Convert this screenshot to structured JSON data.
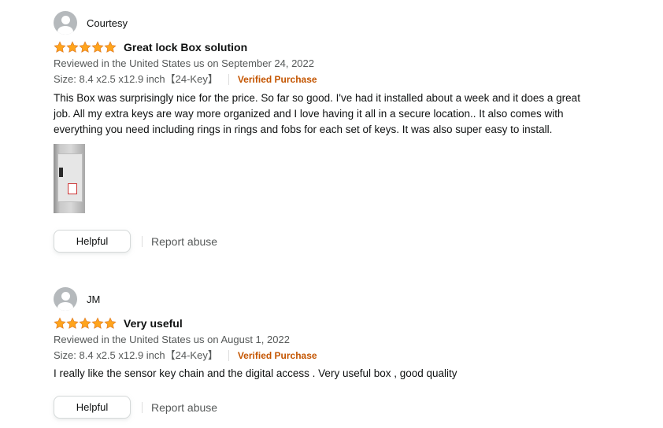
{
  "colors": {
    "star": "#ffa41c",
    "verified": "#c45500",
    "meta_text": "#565959",
    "avatar_bg": "#b5b9bc"
  },
  "icons": {
    "avatar": "avatar-icon",
    "star": "star-icon"
  },
  "reviews": [
    {
      "profile_name": "Courtesy",
      "rating": 5,
      "title": "Great lock Box solution",
      "reviewed_in": "Reviewed in the United States us on September 24, 2022",
      "size": "Size: 8.4 x2.5 x12.9 inch【24-Key】",
      "verified": "Verified Purchase",
      "body": "This Box was surprisingly nice for the price. So far so good. I've had it installed about a week and it does a great job. All my extra keys are way more organized and I love having it all in a secure location.. It also comes with everything you need including rings in rings and fobs for each set of keys. It was also super easy to install.",
      "has_image": true,
      "helpful": "Helpful",
      "report": "Report abuse"
    },
    {
      "profile_name": "JM",
      "rating": 5,
      "title": "Very useful",
      "reviewed_in": "Reviewed in the United States us on August 1, 2022",
      "size": "Size: 8.4 x2.5 x12.9 inch【24-Key】",
      "verified": "Verified Purchase",
      "body": "I really like the sensor key chain and the digital access . Very useful box , good quality",
      "has_image": false,
      "helpful": "Helpful",
      "report": "Report abuse"
    }
  ]
}
